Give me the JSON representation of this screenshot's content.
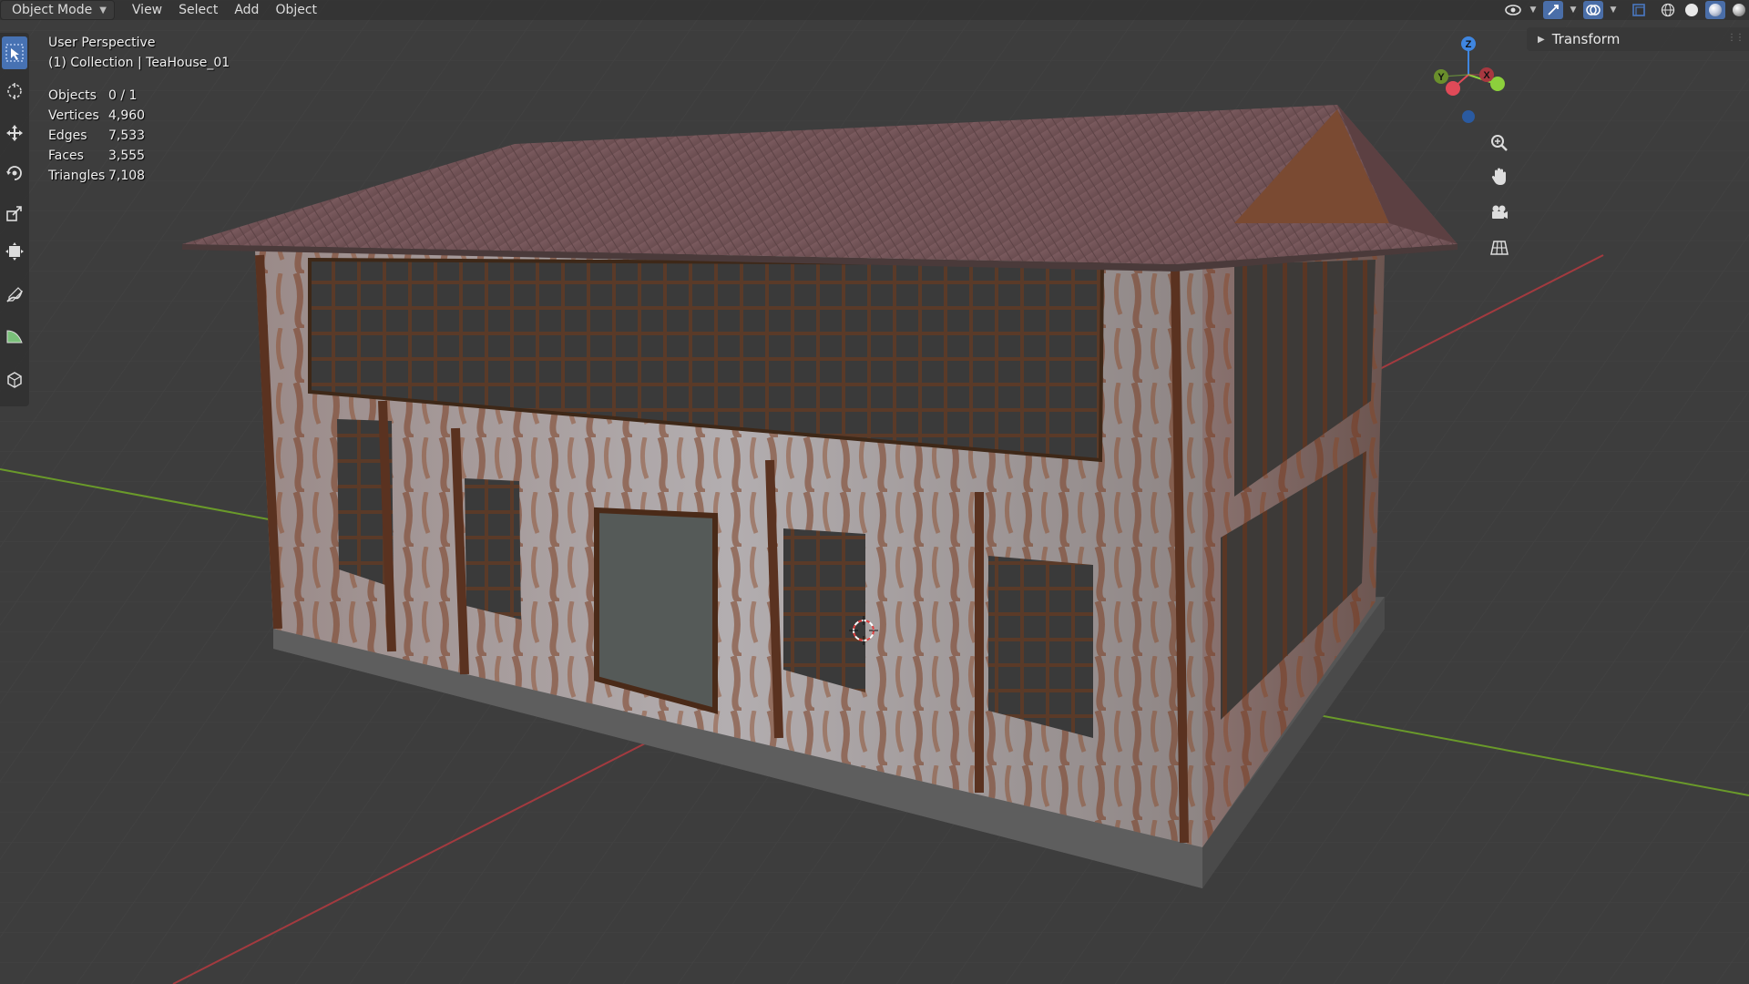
{
  "header": {
    "mode": "Object Mode",
    "menu": [
      "View",
      "Select",
      "Add",
      "Object"
    ]
  },
  "viewport": {
    "perspective_label": "User Perspective",
    "collection_label": "(1) Collection | TeaHouse_01"
  },
  "stats": [
    {
      "label": "Objects",
      "value": "0 / 1"
    },
    {
      "label": "Vertices",
      "value": "4,960"
    },
    {
      "label": "Edges",
      "value": "7,533"
    },
    {
      "label": "Faces",
      "value": "3,555"
    },
    {
      "label": "Triangles",
      "value": "7,108"
    }
  ],
  "gizmo": {
    "x": "X",
    "y": "Y",
    "z": "Z"
  },
  "side_panel": {
    "section": "Transform"
  },
  "colors": {
    "x_axis": "#e04a58",
    "y_axis": "#8cd03c",
    "z_axis": "#3f86e0",
    "accent": "#4772b3",
    "grid_x_line": "#a33a3f",
    "grid_y_line": "#6a9a2a"
  },
  "tools": [
    "select-box-icon",
    "cursor-icon",
    "move-icon",
    "rotate-icon",
    "scale-icon",
    "transform-icon",
    "annotate-icon",
    "measure-icon",
    "add-cube-icon"
  ],
  "nav_buttons": [
    "zoom-icon",
    "pan-hand-icon",
    "camera-icon",
    "ortho-grid-icon"
  ]
}
